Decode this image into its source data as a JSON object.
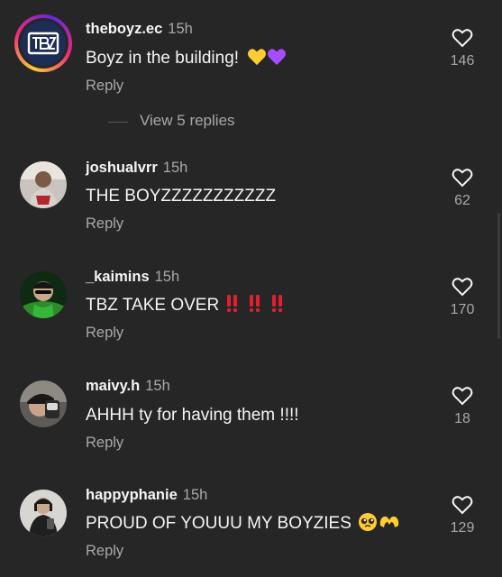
{
  "comments": [
    {
      "username": "theboyz.ec",
      "time": "15h",
      "text": "Boyz in the building!",
      "reply_label": "Reply",
      "likes": "146",
      "avatar": "tbz-logo-avatar",
      "emojis": [
        "yellow-heart-icon",
        "purple-heart-icon"
      ]
    },
    {
      "username": "joshualvrr",
      "time": "15h",
      "text": "THE BOYZZZZZZZZZZZ",
      "reply_label": "Reply",
      "likes": "62",
      "avatar": "user-photo-avatar"
    },
    {
      "username": "_kaimins",
      "time": "15h",
      "text": "TBZ TAKE OVER",
      "reply_label": "Reply",
      "likes": "170",
      "avatar": "user-photo-avatar",
      "emojis": [
        "double-exclamation-icon",
        "double-exclamation-icon",
        "double-exclamation-icon"
      ]
    },
    {
      "username": "maivy.h",
      "time": "15h",
      "text": "AHHH ty for having them !!!!",
      "reply_label": "Reply",
      "likes": "18",
      "avatar": "user-photo-avatar"
    },
    {
      "username": "happyphanie",
      "time": "15h",
      "text": "PROUD OF YOUUU MY BOYZIES",
      "reply_label": "Reply",
      "likes": "129",
      "avatar": "user-photo-avatar",
      "emojis": [
        "pleading-face-icon",
        "heart-hands-icon"
      ]
    }
  ],
  "view_replies_label": "View 5 replies",
  "colors": {
    "background": "#262626",
    "primary_text": "#f5f5f5",
    "secondary_text": "#a8a8a8",
    "yellow_heart": "#ffcc33",
    "purple_heart": "#a64dff",
    "exclamation_red": "#e0202e"
  }
}
